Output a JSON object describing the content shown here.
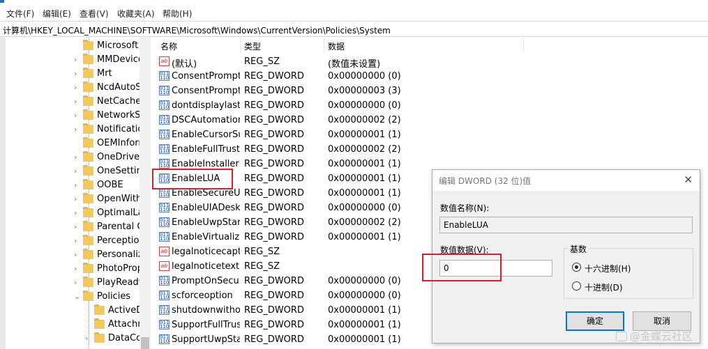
{
  "menu": [
    "文件(F)",
    "编辑(E)",
    "查看(V)",
    "收藏夹(A)",
    "帮助(H)"
  ],
  "address": "计算机\\HKEY_LOCAL_MACHINE\\SOFTWARE\\Microsoft\\Windows\\CurrentVersion\\Policies\\System",
  "tree": {
    "items": [
      {
        "label": "Microsoft",
        "expandable": false
      },
      {
        "label": "MMDevices",
        "expandable": true
      },
      {
        "label": "Mrt",
        "expandable": true
      },
      {
        "label": "NcdAutoSetup",
        "expandable": true
      },
      {
        "label": "NetCache",
        "expandable": true
      },
      {
        "label": "NetworkServiceTriggers",
        "expandable": true
      },
      {
        "label": "Notifications",
        "expandable": true
      },
      {
        "label": "OEMInformation",
        "expandable": false
      },
      {
        "label": "OneDriveRamps",
        "expandable": true
      },
      {
        "label": "OneSettings",
        "expandable": true
      },
      {
        "label": "OOBE",
        "expandable": true
      },
      {
        "label": "OpenWith",
        "expandable": true
      },
      {
        "label": "OptimalLayout",
        "expandable": true
      },
      {
        "label": "Parental Controls",
        "expandable": true
      },
      {
        "label": "PerceptionSimulationExtensions",
        "expandable": true
      },
      {
        "label": "PersonalizationCSP",
        "expandable": true
      },
      {
        "label": "PhotoPropertyHandler",
        "expandable": true
      },
      {
        "label": "PlayReady",
        "expandable": true
      },
      {
        "label": "Policies",
        "expandable": true,
        "expanded": true
      },
      {
        "label": "ActiveDesktop",
        "expandable": false,
        "child": true
      },
      {
        "label": "Attachments",
        "expandable": false,
        "child": true
      },
      {
        "label": "DataCollection",
        "expandable": true,
        "child": true
      }
    ]
  },
  "columns": {
    "name": "名称",
    "type": "类型",
    "data": "数据"
  },
  "rows": [
    {
      "name": "(默认)",
      "type": "REG_SZ",
      "data": "(数值未设置)",
      "kind": "sz"
    },
    {
      "name": "ConsentPromptBehaviorAdmin",
      "type": "REG_DWORD",
      "data": "0x00000000 (0)",
      "kind": "dword"
    },
    {
      "name": "ConsentPromptBehaviorUser",
      "type": "REG_DWORD",
      "data": "0x00000003 (3)",
      "kind": "dword"
    },
    {
      "name": "dontdisplaylastusername",
      "type": "REG_DWORD",
      "data": "0x00000000 (0)",
      "kind": "dword"
    },
    {
      "name": "DSCAutomationHostEnabled",
      "type": "REG_DWORD",
      "data": "0x00000002 (2)",
      "kind": "dword"
    },
    {
      "name": "EnableCursorSuppression",
      "type": "REG_DWORD",
      "data": "0x00000001 (1)",
      "kind": "dword"
    },
    {
      "name": "EnableFullTrustStartupTasks",
      "type": "REG_DWORD",
      "data": "0x00000002 (2)",
      "kind": "dword"
    },
    {
      "name": "EnableInstallerDetection",
      "type": "REG_DWORD",
      "data": "0x00000001 (1)",
      "kind": "dword"
    },
    {
      "name": "EnableLUA",
      "type": "REG_DWORD",
      "data": "0x00000001 (1)",
      "kind": "dword"
    },
    {
      "name": "EnableSecureUIAPaths",
      "type": "REG_DWORD",
      "data": "0x00000001 (1)",
      "kind": "dword"
    },
    {
      "name": "EnableUIADesktopToggle",
      "type": "REG_DWORD",
      "data": "0x00000000 (0)",
      "kind": "dword"
    },
    {
      "name": "EnableUwpStartupTasks",
      "type": "REG_DWORD",
      "data": "0x00000002 (2)",
      "kind": "dword"
    },
    {
      "name": "EnableVirtualization",
      "type": "REG_DWORD",
      "data": "0x00000001 (1)",
      "kind": "dword"
    },
    {
      "name": "legalnoticecaption",
      "type": "REG_SZ",
      "data": "",
      "kind": "sz"
    },
    {
      "name": "legalnoticetext",
      "type": "REG_SZ",
      "data": "",
      "kind": "sz"
    },
    {
      "name": "PromptOnSecureDesktop",
      "type": "REG_DWORD",
      "data": "0x00000000 (0)",
      "kind": "dword"
    },
    {
      "name": "scforceoption",
      "type": "REG_DWORD",
      "data": "0x00000000 (0)",
      "kind": "dword"
    },
    {
      "name": "shutdownwithoutlogon",
      "type": "REG_DWORD",
      "data": "0x00000001 (1)",
      "kind": "dword"
    },
    {
      "name": "SupportFullTrustStartupTasks",
      "type": "REG_DWORD",
      "data": "0x00000001 (1)",
      "kind": "dword"
    },
    {
      "name": "SupportUwpStartupTasks",
      "type": "REG_DWORD",
      "data": "0x00000001 (1)",
      "kind": "dword"
    }
  ],
  "dialog": {
    "title": "编辑 DWORD (32 位)值",
    "value_name_label": "数值名称(N):",
    "value_name": "EnableLUA",
    "value_data_label": "数值数据(V):",
    "value_data": "0",
    "base_label": "基数",
    "hex_label": "十六进制(H)",
    "dec_label": "十进制(D)",
    "ok_label": "确定",
    "cancel_label": "取消"
  },
  "watermark": "@金蝶云社区",
  "colors": {
    "highlight": "#e02020",
    "accent": "#0078d7"
  }
}
